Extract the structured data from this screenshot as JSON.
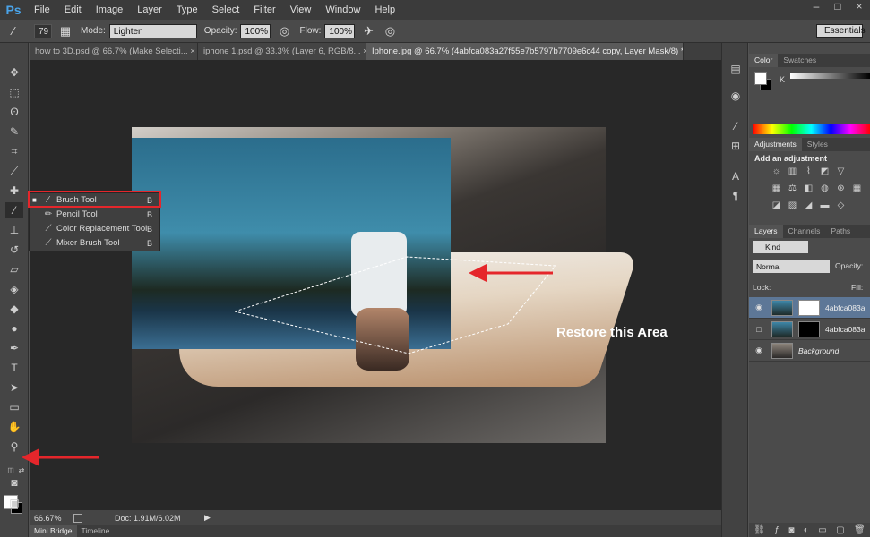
{
  "app": {
    "logo": "Ps",
    "menus": [
      "File",
      "Edit",
      "Image",
      "Layer",
      "Type",
      "Select",
      "Filter",
      "View",
      "Window",
      "Help"
    ],
    "window_controls": [
      "–",
      "□",
      "×"
    ]
  },
  "options": {
    "brush_size": "79",
    "mode_label": "Mode:",
    "mode_value": "Lighten",
    "opacity_label": "Opacity:",
    "opacity_value": "100%",
    "flow_label": "Flow:",
    "flow_value": "100%",
    "workspace": "Essentials"
  },
  "tabs": [
    {
      "label": "how to 3D.psd @ 66.7% (Make Selecti... ×"
    },
    {
      "label": "iphone 1.psd @ 33.3% (Layer 6, RGB/8... ×"
    },
    {
      "label": "Iphone.jpg @ 66.7% (4abfca083a27f55e7b5797b7709e6c44 copy, Layer Mask/8) * ×"
    }
  ],
  "flyout": {
    "items": [
      {
        "label": "Brush Tool",
        "key": "B"
      },
      {
        "label": "Pencil Tool",
        "key": "B"
      },
      {
        "label": "Color Replacement Tool",
        "key": "B"
      },
      {
        "label": "Mixer Brush Tool",
        "key": "B"
      }
    ]
  },
  "annotation": {
    "restore_label": "Restore this Area",
    "arrow_color": "#e5262b"
  },
  "status": {
    "zoom": "66.67%",
    "doc": "Doc: 1.91M/6.02M"
  },
  "bottom_tabs": [
    "Mini Bridge",
    "Timeline"
  ],
  "panels": {
    "color_tabs": [
      "Color",
      "Swatches"
    ],
    "k_label": "K",
    "adjust_tabs": [
      "Adjustments",
      "Styles"
    ],
    "adjust_title": "Add an adjustment",
    "layer_tabs": [
      "Layers",
      "Channels",
      "Paths"
    ],
    "kind_label": "Kind",
    "blend_mode": "Normal",
    "opacity_label": "Opacity:",
    "lock_label": "Lock:",
    "fill_label": "Fill:",
    "layers": [
      {
        "name": "4abfca083a",
        "mask": "white",
        "active": true
      },
      {
        "name": "4abfca083a",
        "mask": "black",
        "active": false
      },
      {
        "name": "Background",
        "mask": "none",
        "active": false
      }
    ]
  }
}
